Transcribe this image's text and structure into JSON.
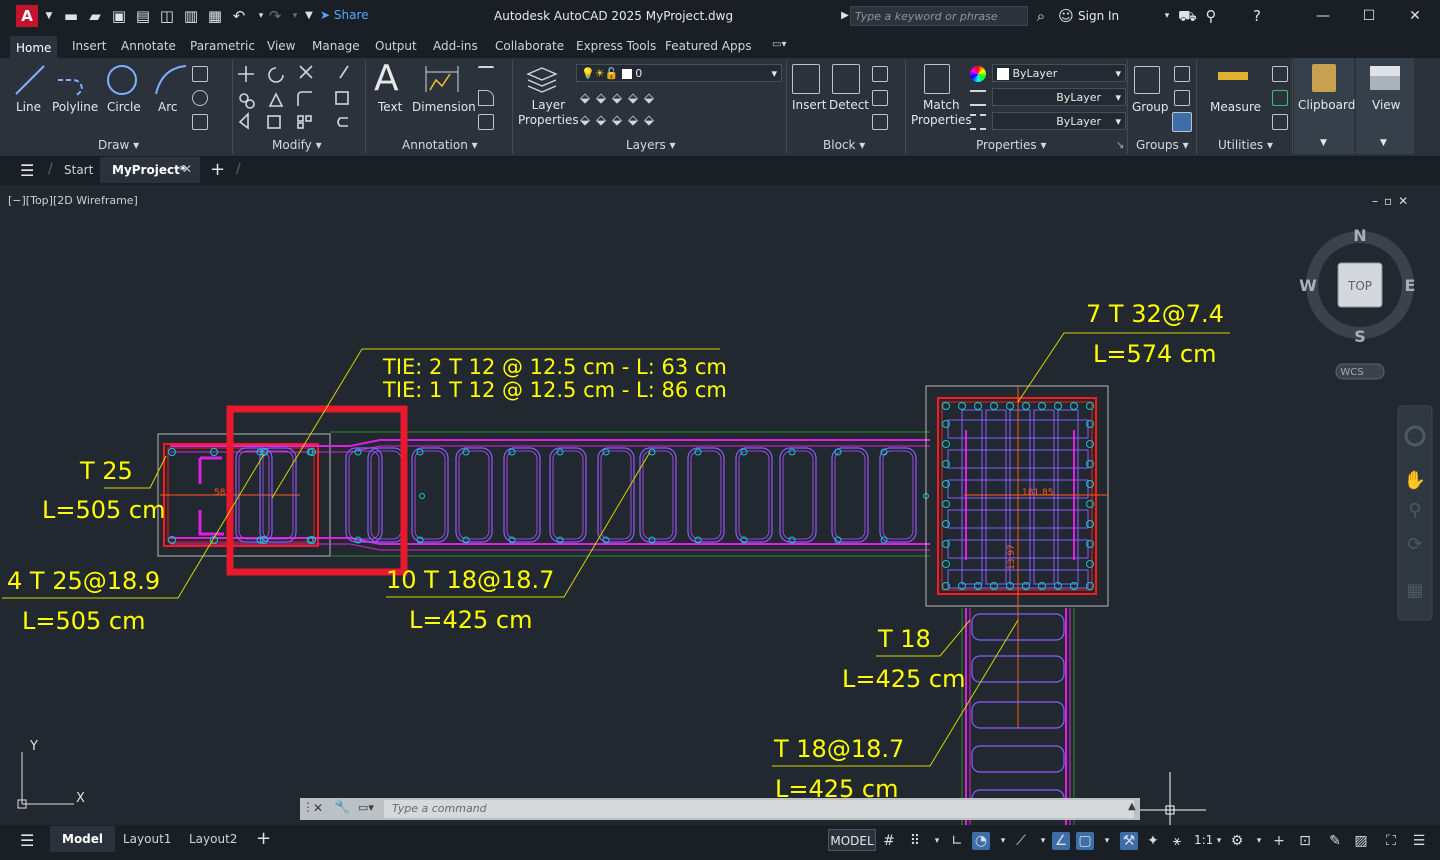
{
  "app": {
    "logo_letter": "A",
    "share_label": "Share",
    "title": "Autodesk AutoCAD 2025    MyProject.dwg",
    "search_placeholder": "Type a keyword or phrase",
    "sign_in": "Sign In"
  },
  "menu": {
    "tabs": [
      "Home",
      "Insert",
      "Annotate",
      "Parametric",
      "View",
      "Manage",
      "Output",
      "Add-ins",
      "Collaborate",
      "Express Tools",
      "Featured Apps"
    ]
  },
  "ribbon": {
    "draw": {
      "line": "Line",
      "polyline": "Polyline",
      "circle": "Circle",
      "arc": "Arc",
      "title": "Draw"
    },
    "modify": {
      "title": "Modify"
    },
    "annotation": {
      "text": "Text",
      "dimension": "Dimension",
      "title": "Annotation"
    },
    "layers": {
      "layer_props_1": "Layer",
      "layer_props_2": "Properties",
      "current_layer": "0",
      "title": "Layers"
    },
    "block": {
      "insert": "Insert",
      "detect": "Detect",
      "title": "Block"
    },
    "properties": {
      "match_1": "Match",
      "match_2": "Properties",
      "color": "ByLayer",
      "linetype": "ByLayer",
      "lineweight": "ByLayer",
      "title": "Properties"
    },
    "groups": {
      "group": "Group",
      "title": "Groups"
    },
    "utilities": {
      "measure": "Measure",
      "title": "Utilities"
    },
    "clipboard": {
      "label": "Clipboard"
    },
    "view": {
      "label": "View"
    }
  },
  "filetabs": {
    "start": "Start",
    "current": "MyProject*"
  },
  "viewport": {
    "label": "[−][Top][2D Wireframe]",
    "viewcube": {
      "n": "N",
      "s": "S",
      "e": "E",
      "w": "W",
      "top": "TOP",
      "wcs": "WCS"
    },
    "ucs": {
      "x": "X",
      "y": "Y"
    }
  },
  "drawing": {
    "tie1": "TIE: 2 T 12  @ 12.5  cm - L: 63  cm",
    "tie2": "TIE: 1 T 12  @ 12.5  cm - L: 86  cm",
    "label_t25": "T 25",
    "label_l505a": "L=505 cm",
    "label_4t25": "4 T 25@18.9",
    "label_l505b": "L=505 cm",
    "label_10t18": "10 T 18@18.7",
    "label_l425a": "L=425 cm",
    "label_7t32": "7 T 32@7.4",
    "label_l574": "L=574 cm",
    "label_t18": "T 18",
    "label_l425b": "L=425 cm",
    "label_t18b": "T 18@18.7",
    "label_l425c": "L=425 cm",
    "dim_left": "58",
    "dim_right": "181.85",
    "dim_vert": "13.97"
  },
  "command": {
    "placeholder": "Type  a  command"
  },
  "status": {
    "model_tab": "Model",
    "layout1": "Layout1",
    "layout2": "Layout2",
    "model_btn": "MODEL",
    "scale": "1:1"
  },
  "colors": {
    "highlight": "#e8192c",
    "rebar_magenta": "#e020e0",
    "rebar_red": "#ff1a1a",
    "text_yellow": "#ffff00",
    "leader": "#d4d400",
    "dim_orange": "#ff5a14"
  }
}
